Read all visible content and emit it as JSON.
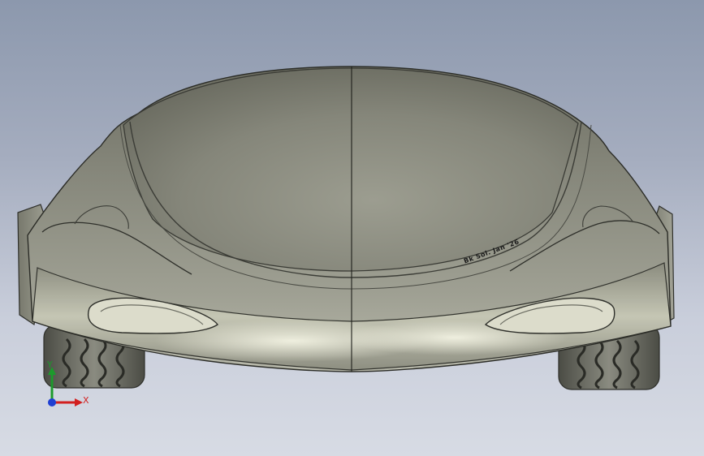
{
  "viewport": {
    "background_top": "#8c98ad",
    "background_bottom": "#d7dbe4",
    "model_color": "#8f9080"
  },
  "model": {
    "engraved_text": "Bk Sol. Jan '26"
  },
  "triad": {
    "x_label": "X",
    "y_label": "Y",
    "x_color": "#d21f1f",
    "y_color": "#1c9a2c",
    "z_color": "#1f3fd2"
  }
}
